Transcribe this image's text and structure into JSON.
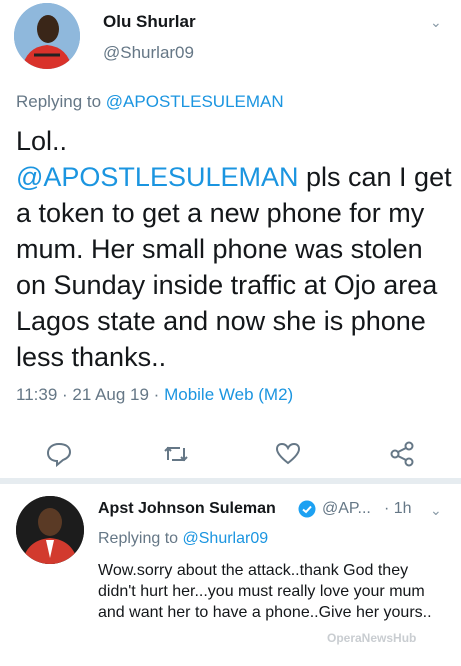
{
  "tweet1": {
    "name": "Olu Shurlar",
    "handle": "@Shurlar09",
    "replying_prefix": "Replying to ",
    "replying_handle": "@APOSTLESULEMAN",
    "body_line1": "Lol..",
    "body_mention": "@APOSTLESULEMAN",
    "body_rest": " pls can I get a token to get a new phone for my mum. Her small phone was stolen on Sunday inside traffic at Ojo area Lagos state and now she is phone less thanks..",
    "time": "11:39 · 21 Aug 19 · ",
    "source": "Mobile Web (M2)",
    "actions": [
      {
        "name": "reply-icon",
        "icon": "reply"
      },
      {
        "name": "retweet-icon",
        "icon": "retweet"
      },
      {
        "name": "like-icon",
        "icon": "heart"
      },
      {
        "name": "share-icon",
        "icon": "share"
      }
    ]
  },
  "tweet2": {
    "name": "Apst Johnson Suleman",
    "handle": "@AP...",
    "time": "· 1h",
    "replying_prefix": "Replying to ",
    "replying_handle": "@Shurlar09",
    "body": "Wow.sorry about the attack..thank God they didn't hurt her...you must really love your mum and  want her to have a phone..Give her yours..",
    "verified_color": "#1da1f2"
  },
  "watermark": "OperaNewsHub",
  "colors": {
    "link": "#1b95e0",
    "muted": "#657786"
  }
}
